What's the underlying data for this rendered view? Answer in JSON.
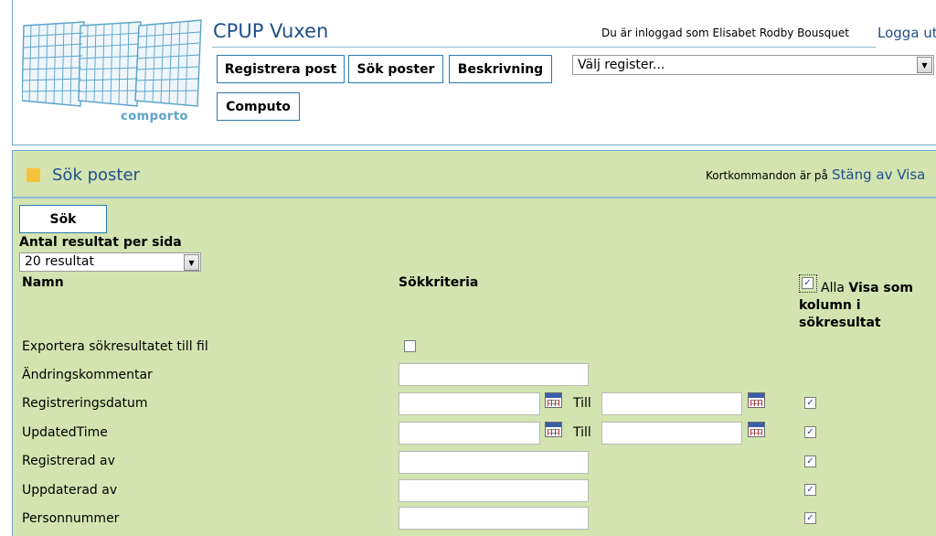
{
  "header": {
    "logo_text": "comporto",
    "app_title": "CPUP Vuxen",
    "user_info": "Du är inloggad som Elisabet Rodby Bousquet",
    "logout_label": "Logga ut",
    "nav": {
      "register_post": "Registrera post",
      "search_posts": "Sök poster",
      "description": "Beskrivning",
      "computo": "Computo"
    },
    "register_select": {
      "selected": "Välj register..."
    }
  },
  "panel": {
    "title": "Sök poster",
    "shortcut_text": "Kortkommandon är på",
    "shortcut_link": "Stäng av Visa"
  },
  "form": {
    "search_button": "Sök",
    "results_per_page_label": "Antal resultat per sida",
    "results_per_page_value": "20 resultat",
    "col_name": "Namn",
    "col_criteria": "Sökkriteria",
    "col_all": "Alla",
    "col_show_as_column": "Visa som kolumn i sökresultat",
    "till_label": "Till",
    "rows": [
      {
        "label": "Exportera sökresultatet till fil",
        "type": "checkbox",
        "checked": false
      },
      {
        "label": "Ändringskommentar",
        "type": "text",
        "value": ""
      },
      {
        "label": "Registreringsdatum",
        "type": "daterange",
        "from": "",
        "to": "",
        "show_column": true
      },
      {
        "label": "UpdatedTime",
        "type": "daterange",
        "from": "",
        "to": "",
        "show_column": true
      },
      {
        "label": "Registrerad av",
        "type": "text",
        "value": "",
        "show_column": true
      },
      {
        "label": "Uppdaterad av",
        "type": "text",
        "value": "",
        "show_column": true
      },
      {
        "label": "Personnummer",
        "type": "text",
        "value": "",
        "show_column": true
      }
    ],
    "all_checked": true
  },
  "colors": {
    "panel_bg": "#d3e4b0",
    "title_blue": "#1f4f8b",
    "border_blue": "#2a7ab0",
    "marker_yellow": "#f5c23a"
  }
}
